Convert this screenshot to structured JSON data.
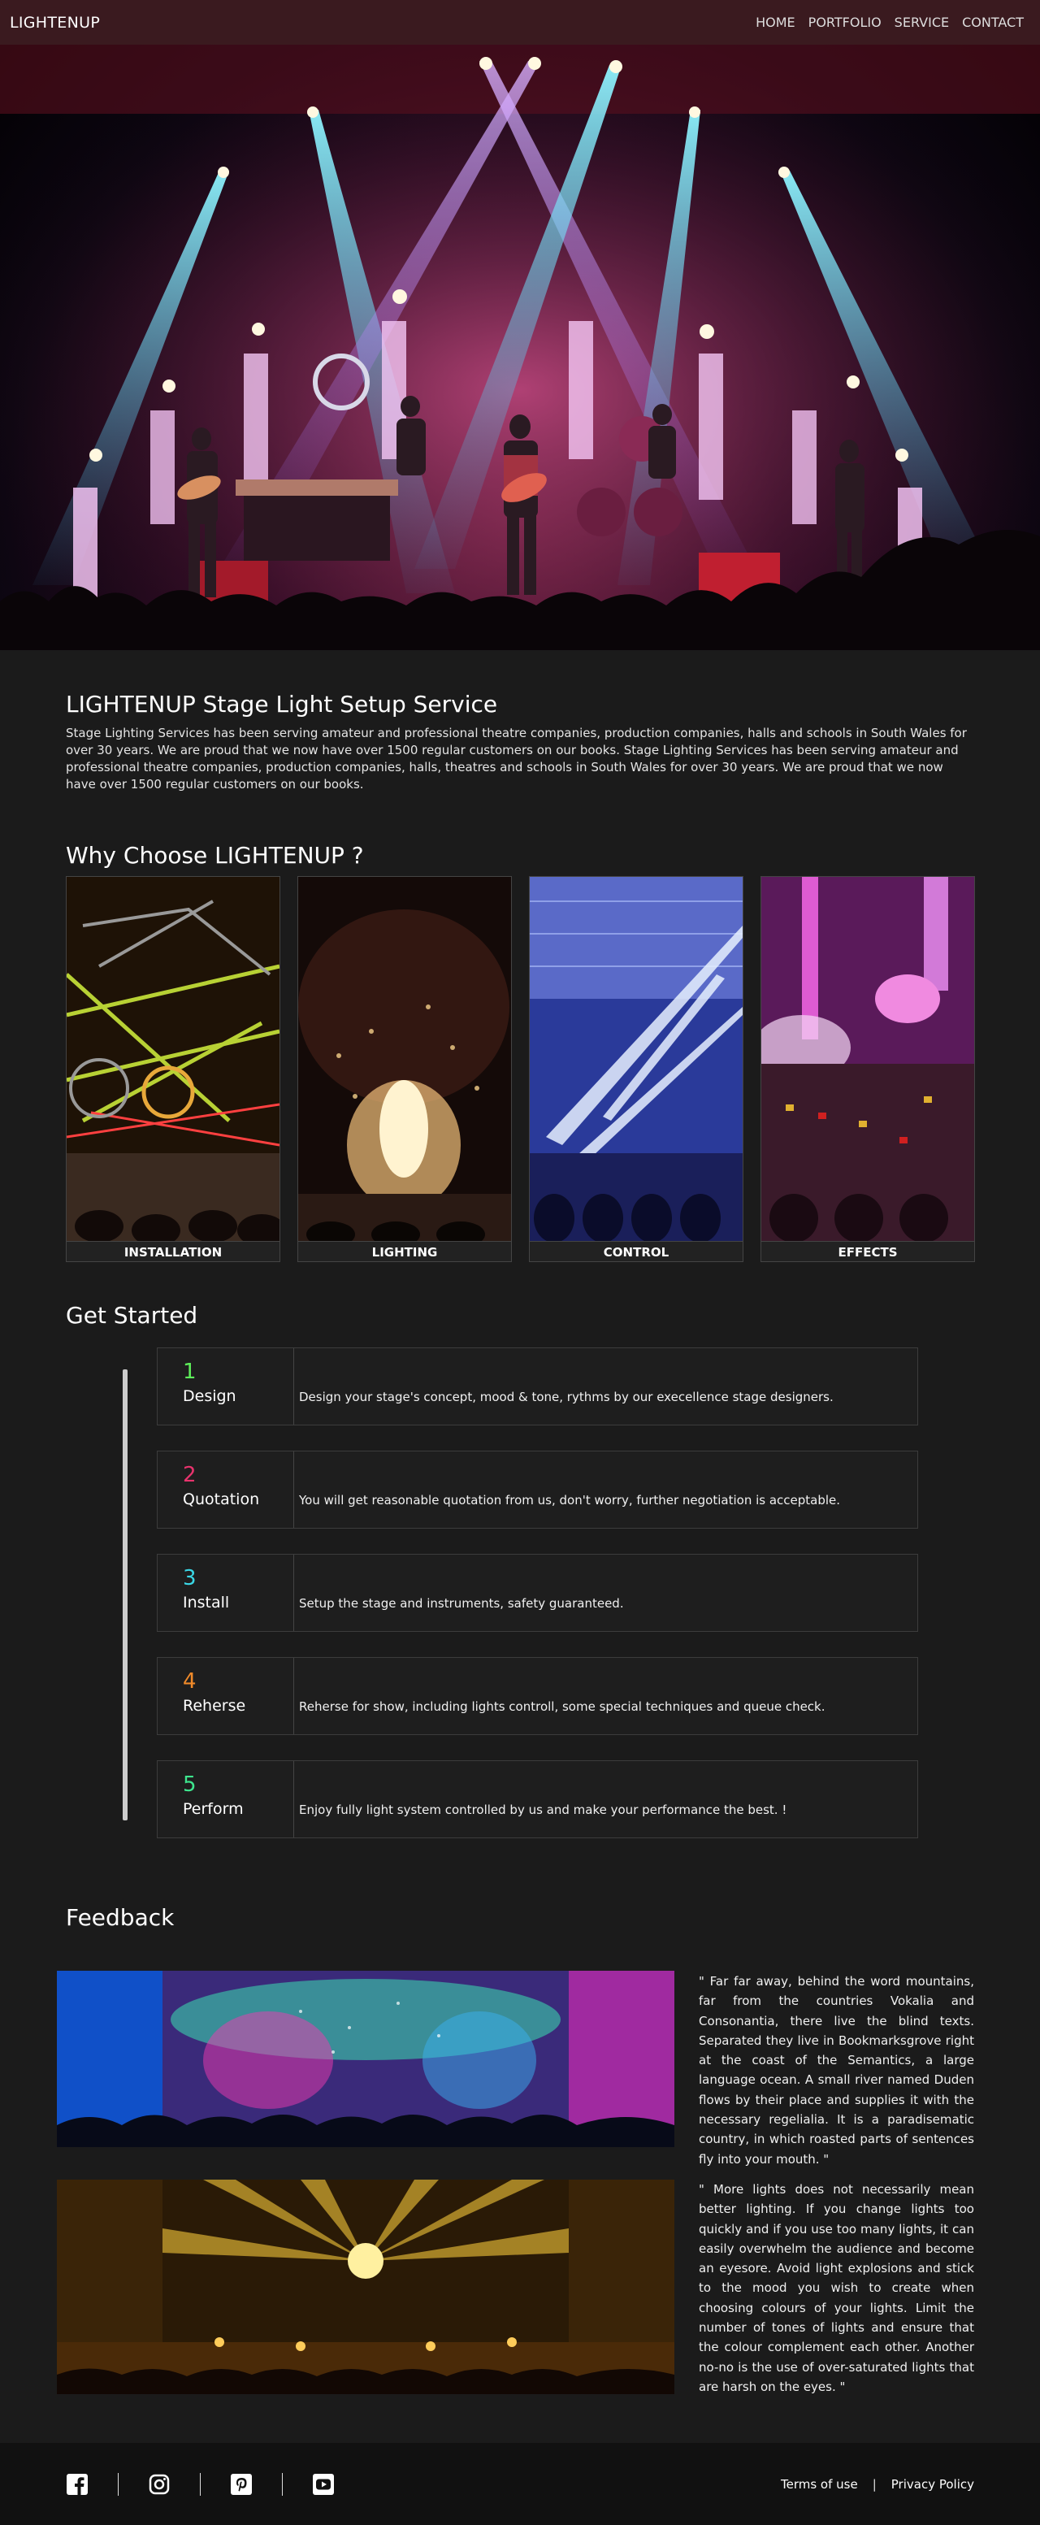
{
  "nav": {
    "brand": "LIGHTENUP",
    "items": [
      "HOME",
      "PORTFOLIO",
      "SERVICE",
      "CONTACT"
    ]
  },
  "intro": {
    "title": "LIGHTENUP Stage Light Setup Service",
    "text": "Stage Lighting Services has been serving amateur and professional theatre companies, production companies, halls and schools in South Wales for over 30 years. We are proud that we now have over 1500 regular customers on our books. Stage Lighting Services has been serving amateur and professional theatre companies, production companies, halls, theatres and schools in South Wales for over 30 years. We are proud that we now have over 1500 regular customers on our books."
  },
  "why": {
    "title": "Why Choose LIGHTENUP ?",
    "cards": [
      {
        "caption": "INSTALLATION"
      },
      {
        "caption": "LIGHTING"
      },
      {
        "caption": "CONTROL"
      },
      {
        "caption": "EFFECTS"
      }
    ]
  },
  "get_started": {
    "title": "Get Started",
    "steps": [
      {
        "num": "1",
        "name": "Design",
        "desc": "Design your stage's concept, mood & tone, rythms by our execellence stage designers.",
        "color": "#5ef05a"
      },
      {
        "num": "2",
        "name": "Quotation",
        "desc": "You will get reasonable quotation from us, don't worry, further negotiation is acceptable.",
        "color": "#e8336d"
      },
      {
        "num": "3",
        "name": "Install",
        "desc": "Setup the stage and instruments, safety guaranteed.",
        "color": "#3ad7e6"
      },
      {
        "num": "4",
        "name": "Reherse",
        "desc": "Reherse for show, including lights controll, some special techniques and queue check.",
        "color": "#f08a2a"
      },
      {
        "num": "5",
        "name": "Perform",
        "desc": "Enjoy fully light system controlled by us and make your performance the best. !",
        "color": "#3ee68e"
      }
    ]
  },
  "feedback": {
    "title": "Feedback",
    "items": [
      {
        "text": "\" Far far away, behind the word mountains, far from the countries Vokalia and Consonantia, there live the blind texts. Separated they live in Bookmarksgrove right at the coast of the Semantics, a large language ocean. A small river named Duden flows by their place and supplies it with the necessary regelialia. It is a paradisematic country, in which roasted parts of sentences fly into your mouth. \""
      },
      {
        "text": "\" More lights does not necessarily mean better lighting. If you change lights too quickly and if you use too many lights, it can easily overwhelm the audience and become an eyesore. Avoid light explosions and stick to the mood you wish to create when choosing colours of your lights. Limit the number of tones of lights and ensure that the colour complement each other. Another no-no is the use of over-saturated lights that are harsh on the eyes. \""
      }
    ]
  },
  "footer": {
    "social": [
      "facebook-icon",
      "instagram-icon",
      "pinterest-icon",
      "youtube-icon"
    ],
    "links": [
      "Terms of use",
      "Privacy Policy"
    ],
    "separator": "|"
  }
}
